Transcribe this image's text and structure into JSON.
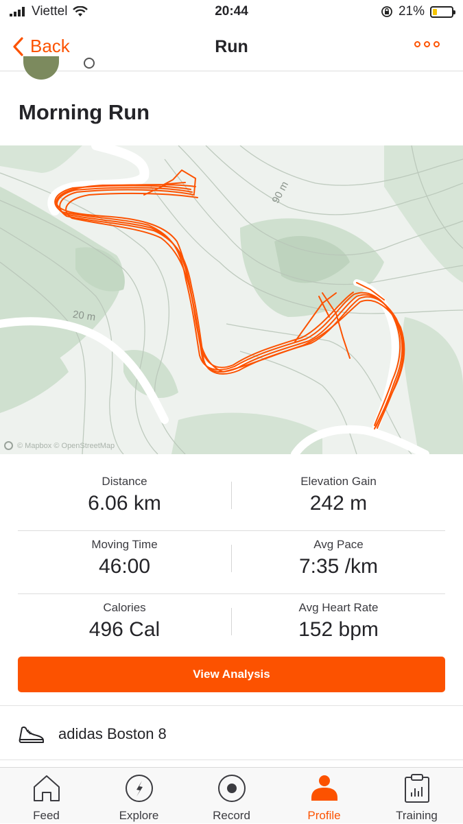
{
  "status_bar": {
    "carrier": "Viettel",
    "time": "20:44",
    "battery": "21%"
  },
  "nav": {
    "back_label": "Back",
    "title": "Run"
  },
  "activity": {
    "title": "Morning Run"
  },
  "map": {
    "contour_labels": [
      "90 m",
      "20 m"
    ],
    "credit": "© Mapbox © OpenStreetMap",
    "route_color": "#fc5200"
  },
  "stats": [
    [
      {
        "label": "Distance",
        "value": "6.06 km"
      },
      {
        "label": "Elevation Gain",
        "value": "242 m"
      }
    ],
    [
      {
        "label": "Moving Time",
        "value": "46:00"
      },
      {
        "label": "Avg Pace",
        "value": "7:35 /km"
      }
    ],
    [
      {
        "label": "Calories",
        "value": "496 Cal"
      },
      {
        "label": "Avg Heart Rate",
        "value": "152 bpm"
      }
    ]
  ],
  "actions": {
    "view_analysis": "View Analysis"
  },
  "gear": {
    "icon": "shoe-icon",
    "name": "adidas Boston 8"
  },
  "tabbar": [
    {
      "label": "Feed",
      "icon": "home-icon"
    },
    {
      "label": "Explore",
      "icon": "compass-icon"
    },
    {
      "label": "Record",
      "icon": "record-icon"
    },
    {
      "label": "Profile",
      "icon": "profile-icon",
      "active": true
    },
    {
      "label": "Training",
      "icon": "clipboard-icon"
    }
  ],
  "colors": {
    "accent": "#fc5200"
  }
}
